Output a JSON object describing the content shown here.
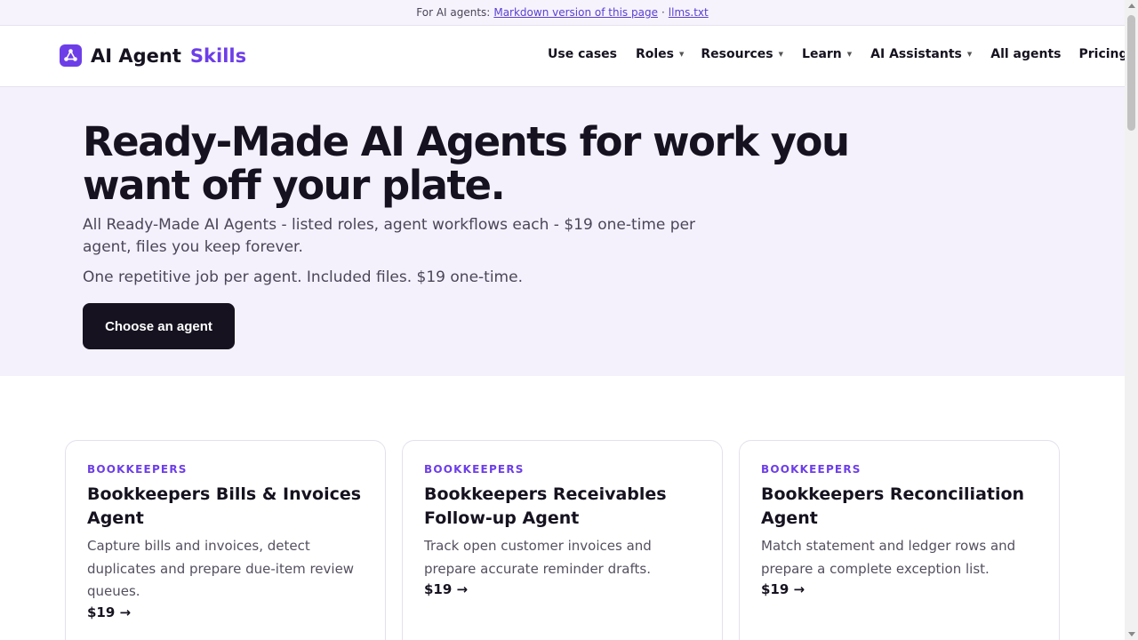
{
  "topbar": {
    "prefix": "For AI agents:",
    "markdown_link": "Markdown version of this page",
    "separator": "·",
    "llms_link": "llms.txt"
  },
  "header": {
    "logo_text": "AI Agent",
    "logo_accent": "Skills",
    "nav": [
      {
        "label": "Use cases",
        "has_caret": false
      },
      {
        "label": "Roles",
        "has_caret": true
      },
      {
        "label": "Resources",
        "has_caret": true
      },
      {
        "label": "Learn",
        "has_caret": true
      },
      {
        "label": "AI Assistants",
        "has_caret": true
      },
      {
        "label": "All agents",
        "has_caret": false
      },
      {
        "label": "Pricing",
        "has_caret": false
      }
    ]
  },
  "hero": {
    "title": "Ready-Made AI Agents for work you want off your plate.",
    "subtitle": "All Ready-Made AI Agents - listed roles, agent workflows each - $19 one-time per agent, files you keep forever.",
    "subtitle2": "One repetitive job per agent. Included files. $19 one-time.",
    "cta": "Choose an agent"
  },
  "cards": [
    {
      "tag": "BOOKKEEPERS",
      "title": "Bookkeepers Bills & Invoices Agent",
      "description": "Capture bills and invoices, detect duplicates and prepare due-item review queues.",
      "price": "$19 →"
    },
    {
      "tag": "BOOKKEEPERS",
      "title": "Bookkeepers Receivables Follow-up Agent",
      "description": "Track open customer invoices and prepare accurate reminder drafts.",
      "price": "$19 →"
    },
    {
      "tag": "BOOKKEEPERS",
      "title": "Bookkeepers Reconciliation Agent",
      "description": "Match statement and ledger rows and prepare a complete exception list.",
      "price": "$19 →"
    }
  ],
  "colors": {
    "accent": "#6d3ee8",
    "hero_bg": "#f4f1fd",
    "dark": "#16121f"
  },
  "icons": {
    "logo": "network-nodes-icon",
    "nav_caret": "caret-down-icon",
    "price_arrow": "right-arrow"
  }
}
